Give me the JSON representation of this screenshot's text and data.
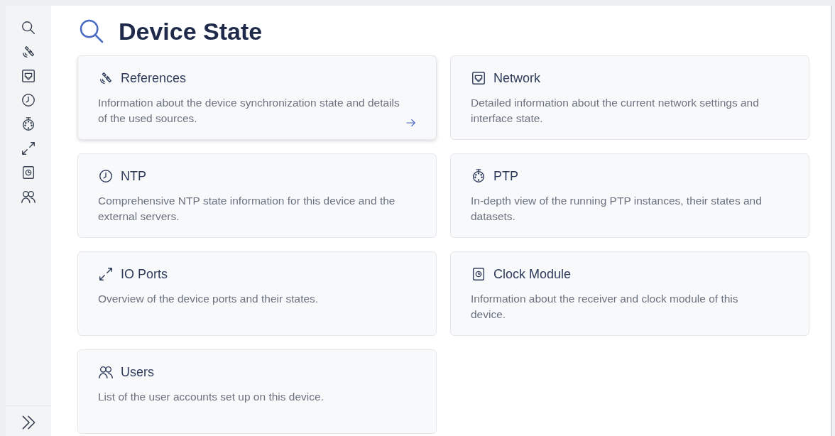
{
  "sidebar": {
    "items": [
      {
        "kind": "search"
      },
      {
        "kind": "satellite"
      },
      {
        "kind": "network"
      },
      {
        "kind": "clock"
      },
      {
        "kind": "stopwatch"
      },
      {
        "kind": "ports"
      },
      {
        "kind": "module"
      },
      {
        "kind": "users"
      }
    ],
    "expand": {
      "kind": "expand"
    }
  },
  "page": {
    "title": "Device State"
  },
  "cards": [
    {
      "kind": "satellite",
      "title": "References",
      "description": "Information about the device synchronization state and details of the used sources.",
      "hovered": true
    },
    {
      "kind": "network",
      "title": "Network",
      "description": "Detailed information about the current network settings and interface state.",
      "hovered": false
    },
    {
      "kind": "clock",
      "title": "NTP",
      "description": "Comprehensive NTP state information for this device and the external servers.",
      "hovered": false
    },
    {
      "kind": "stopwatch",
      "title": "PTP",
      "description": "In-depth view of the running PTP instances, their states and datasets.",
      "hovered": false
    },
    {
      "kind": "ports",
      "title": "IO Ports",
      "description": "Overview of the device ports and their states.",
      "hovered": false
    },
    {
      "kind": "module",
      "title": "Clock Module",
      "description": "Information about the receiver and clock module of this device.",
      "hovered": false
    },
    {
      "kind": "users",
      "title": "Users",
      "description": "List of the user accounts set up on this device.",
      "hovered": false
    }
  ]
}
